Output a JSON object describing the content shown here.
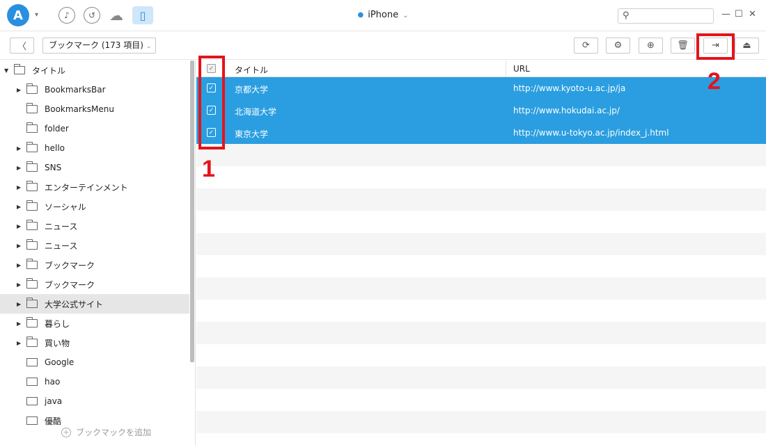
{
  "titlebar": {
    "logo_letter": "A",
    "device_name": "iPhone",
    "icons": [
      "music-icon",
      "history-icon",
      "cloud-icon",
      "phone-icon"
    ],
    "search_placeholder": ""
  },
  "toolbar": {
    "dropdown_label": "ブックマーク (173 項目)",
    "buttons": [
      "refresh-icon",
      "settings-icon",
      "add-icon",
      "delete-icon",
      "export-to-pc-icon",
      "export-to-device-icon"
    ]
  },
  "sidebar": {
    "root_label": "タイトル",
    "items": [
      {
        "label": "BookmarksBar",
        "type": "folder",
        "expandable": true
      },
      {
        "label": "BookmarksMenu",
        "type": "folder",
        "expandable": false
      },
      {
        "label": "folder",
        "type": "folder",
        "expandable": false
      },
      {
        "label": "hello",
        "type": "folder",
        "expandable": true
      },
      {
        "label": "SNS",
        "type": "folder",
        "expandable": true
      },
      {
        "label": "エンターテインメント",
        "type": "folder",
        "expandable": true
      },
      {
        "label": "ソーシャル",
        "type": "folder",
        "expandable": true
      },
      {
        "label": "ニュース",
        "type": "folder",
        "expandable": true
      },
      {
        "label": "ニュース",
        "type": "folder",
        "expandable": true
      },
      {
        "label": "ブックマーク",
        "type": "folder",
        "expandable": true
      },
      {
        "label": "ブックマーク",
        "type": "folder",
        "expandable": true
      },
      {
        "label": "大学公式サイト",
        "type": "folder",
        "expandable": true,
        "selected": true
      },
      {
        "label": "暮らし",
        "type": "folder",
        "expandable": true
      },
      {
        "label": "買い物",
        "type": "folder",
        "expandable": true
      },
      {
        "label": "Google",
        "type": "bookmark",
        "expandable": false
      },
      {
        "label": "hao",
        "type": "bookmark",
        "expandable": false
      },
      {
        "label": "java",
        "type": "bookmark",
        "expandable": false
      },
      {
        "label": "優酷",
        "type": "bookmark",
        "expandable": false
      }
    ],
    "add_label": "ブックマックを追加"
  },
  "table": {
    "columns": [
      "タイトル",
      "URL"
    ],
    "rows": [
      {
        "title": "京都大学",
        "url": "http://www.kyoto-u.ac.jp/ja",
        "checked": true
      },
      {
        "title": "北海道大学",
        "url": "http://www.hokudai.ac.jp/",
        "checked": true
      },
      {
        "title": "東京大学",
        "url": "http://www.u-tokyo.ac.jp/index_j.html",
        "checked": true
      }
    ]
  },
  "annotations": {
    "step1": "1",
    "step2": "2",
    "color": "#e4141b"
  },
  "colors": {
    "accent": "#2a9ee0",
    "selection": "#2a9ee0"
  }
}
